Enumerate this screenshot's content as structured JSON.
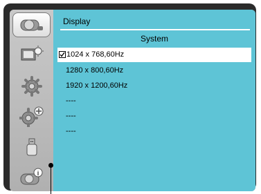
{
  "menu": {
    "title": "Display",
    "section": "System",
    "items": [
      {
        "label": "1024 x 768,60Hz",
        "checked": true
      },
      {
        "label": "1280 x 800,60Hz",
        "checked": false
      },
      {
        "label": "1920 x 1200,60Hz",
        "checked": false
      },
      {
        "label": "----",
        "checked": false
      },
      {
        "label": "----",
        "checked": false
      },
      {
        "label": "----",
        "checked": false
      }
    ]
  },
  "sidebar": {
    "icons": [
      "projector-icon",
      "picture-settings-icon",
      "gear-icon",
      "advanced-gear-icon",
      "usb-icon",
      "info-icon"
    ],
    "active_index": 0
  },
  "colors": {
    "panel": "#5ec4d6",
    "frame": "#2b2b2b",
    "sidebar": "#b8b8b8"
  }
}
